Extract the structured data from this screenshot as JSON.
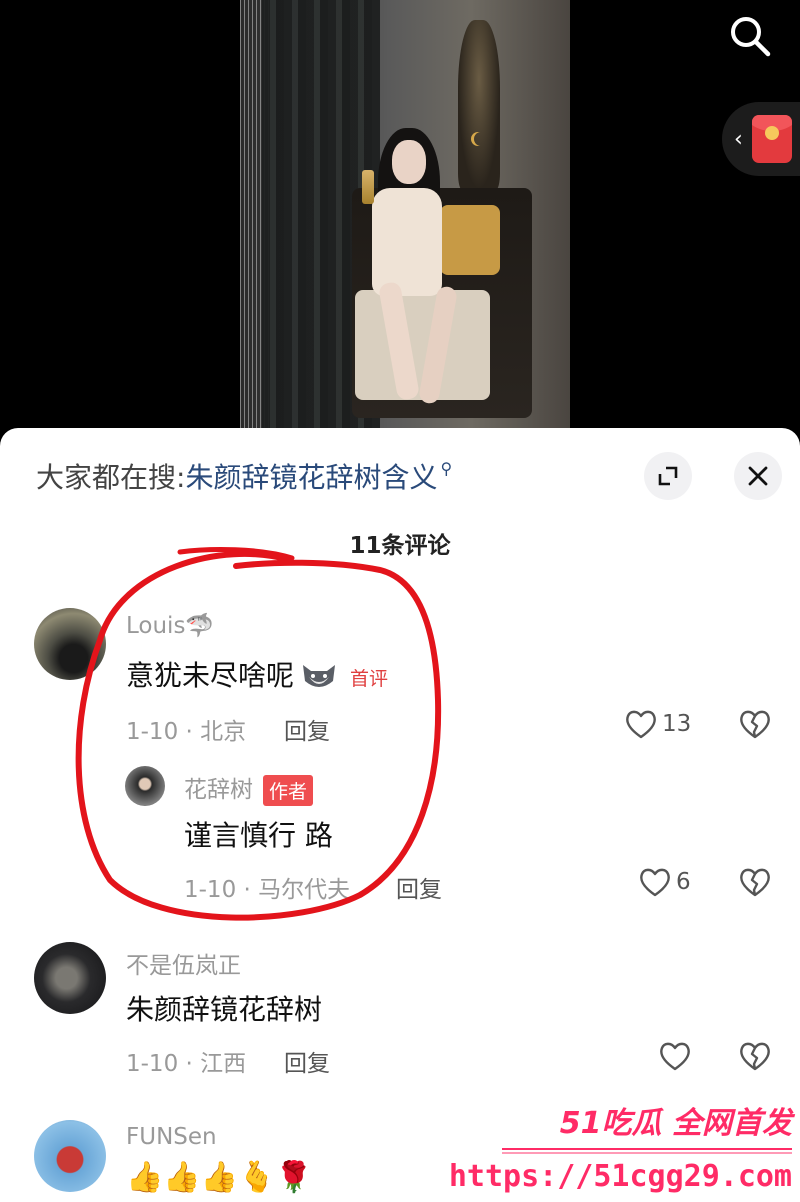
{
  "search": {
    "prefix": "大家都在搜:",
    "term": "朱颜辞镜花辞树含义"
  },
  "comments_header": {
    "count_label": "11条评论"
  },
  "comments": [
    {
      "user": "Louis🦈",
      "text": "意犹未尽啥呢",
      "badge": "首评",
      "date_location": "1-10 · 北京",
      "reply_label": "回复",
      "likes": "13",
      "reply": {
        "user": "花辞树",
        "badge": "作者",
        "text": "谨言慎行 路",
        "date_location": "1-10 · 马尔代夫",
        "reply_label": "回复",
        "likes": "6"
      }
    },
    {
      "user": "不是伍岚正",
      "text": "朱颜辞镜花辞树",
      "date_location": "1-10 · 江西",
      "reply_label": "回复",
      "likes": ""
    },
    {
      "user": "FUNSen",
      "text": "👍👍👍🫰🌹"
    }
  ],
  "watermark": {
    "brand": "51吃瓜 全网首发",
    "url": "https://51cgg29.com"
  },
  "colors": {
    "accent_red": "#ef4d4f",
    "annotation_red": "#e3141b",
    "watermark_pink": "#ff2b66",
    "search_link": "#2a4a7a"
  },
  "icons": [
    "search-icon",
    "red-envelope-icon",
    "expand-icon",
    "close-icon",
    "heart-icon",
    "broken-heart-icon"
  ]
}
